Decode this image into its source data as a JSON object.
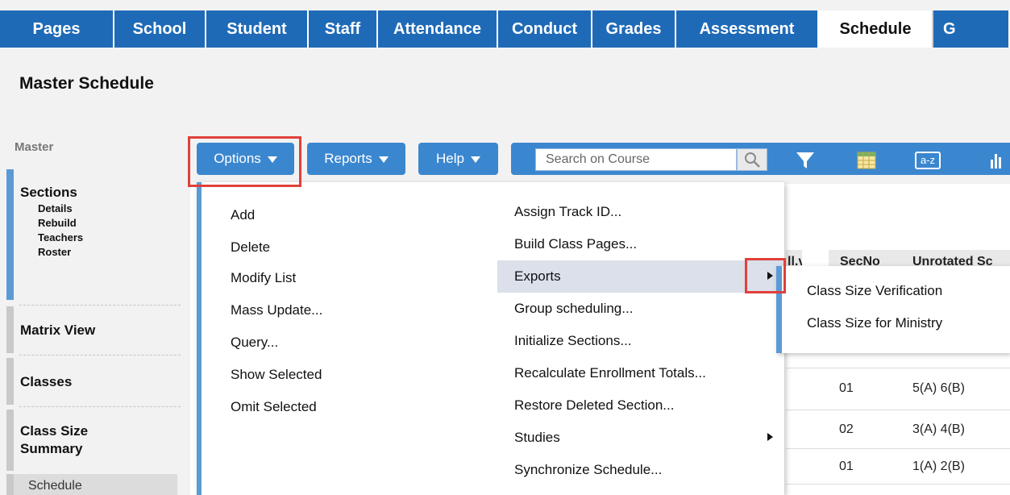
{
  "nav": {
    "tabs": [
      "Pages",
      "School",
      "Student",
      "Staff",
      "Attendance",
      "Conduct",
      "Grades",
      "Assessment",
      "Schedule",
      "G"
    ],
    "active_tab": "Schedule"
  },
  "page_title": "Master Schedule",
  "sidebar": {
    "heading": "Master",
    "sections": {
      "label": "Sections",
      "subitems": [
        "Details",
        "Rebuild",
        "Teachers",
        "Roster"
      ]
    },
    "matrix_view": "Matrix View",
    "classes": "Classes",
    "class_size_summary": [
      "Class Size",
      "Summary"
    ],
    "next_item": "Schedule"
  },
  "toolbar": {
    "options_label": "Options",
    "reports_label": "Reports",
    "help_label": "Help",
    "search_placeholder": "Search on Course",
    "sort_label": "a-z",
    "icons": [
      "search-icon",
      "filter-icon",
      "grid-icon",
      "sort-az-icon",
      "bar-chart-icon"
    ]
  },
  "options_menu": {
    "left_items": [
      "Add",
      "Delete",
      "Modify List",
      "Mass Update...",
      "Query...",
      "Show Selected",
      "Omit Selected"
    ],
    "right_items": [
      {
        "label": "Assign Track ID...",
        "submenu": false
      },
      {
        "label": "Build Class Pages...",
        "submenu": false
      },
      {
        "label": "Exports",
        "submenu": true,
        "highlighted": true
      },
      {
        "label": "Group scheduling...",
        "submenu": false
      },
      {
        "label": "Initialize Sections...",
        "submenu": false
      },
      {
        "label": "Recalculate Enrollment Totals...",
        "submenu": false
      },
      {
        "label": "Restore Deleted Section...",
        "submenu": false
      },
      {
        "label": "Studies",
        "submenu": true
      },
      {
        "label": "Synchronize Schedule...",
        "submenu": false
      }
    ]
  },
  "exports_submenu": {
    "items": [
      "Class Size Verification",
      "Class Size for Ministry"
    ]
  },
  "table": {
    "headers": [
      "SecNo",
      "Unrotated Sc"
    ],
    "rows": [
      {
        "secno": "01",
        "unrotated": "5(A) 6(B)"
      },
      {
        "secno": "02",
        "unrotated": "3(A) 4(B)"
      },
      {
        "secno": "01",
        "unrotated": "1(A) 2(B)"
      }
    ]
  },
  "colors": {
    "nav_blue": "#1f6ab7",
    "button_blue": "#3b87cf",
    "accent_blue": "#5b9bd5",
    "highlight_red": "#e0403a",
    "menu_highlight": "#dbe0ea"
  }
}
